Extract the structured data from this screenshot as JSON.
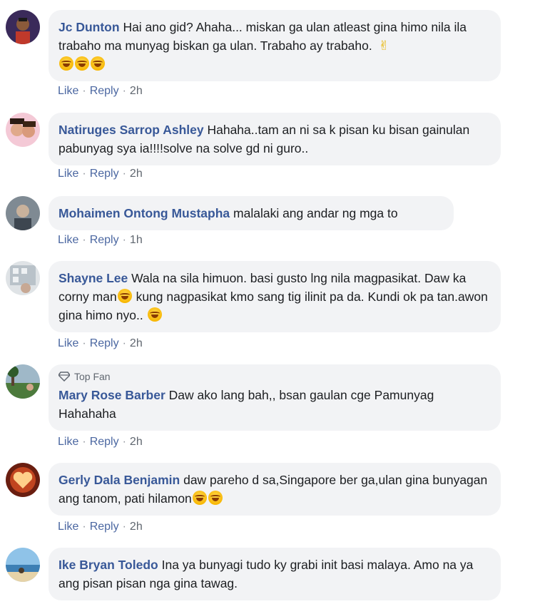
{
  "comments": [
    {
      "name": "Jc Dunton",
      "text": "Hai ano gid? Ahaha... miskan ga ulan atleast gina himo nila ila trabaho ma munyag biskan ga ulan. Trabaho ay trabaho.",
      "like": "Like",
      "reply": "Reply",
      "time": "2h",
      "avatar": "avatar-young-man"
    },
    {
      "name": "Natiruges Sarrop Ashley",
      "text": "Hahaha..tam an ni sa k pisan ku bisan gainulan pabunyag sya ia!!!!solve na solve gd ni guro..",
      "like": "Like",
      "reply": "Reply",
      "time": "2h",
      "avatar": "avatar-two-people"
    },
    {
      "name": "Mohaimen Ontong Mustapha",
      "text": "malalaki ang andar ng mga to",
      "like": "Like",
      "reply": "Reply",
      "time": "1h",
      "avatar": "avatar-man-grey"
    },
    {
      "name": "Shayne Lee",
      "text1": "Wala na sila himuon. basi gusto lng nila magpasikat. Daw ka corny man",
      "text2": "kung nagpasikat kmo sang tig ilinit pa da. Kundi ok pa tan.awon gina himo nyo..",
      "like": "Like",
      "reply": "Reply",
      "time": "2h",
      "avatar": "avatar-building"
    },
    {
      "badge": "Top Fan",
      "name": "Mary Rose Barber",
      "text": "Daw ako lang bah,, bsan gaulan cge Pamunyag Hahahaha",
      "like": "Like",
      "reply": "Reply",
      "time": "2h",
      "avatar": "avatar-park"
    },
    {
      "name": "Gerly Dala Benjamin",
      "text": "daw pareho d sa,Singapore ber ga,ulan gina bunyagan ang tanom, pati hilamon",
      "like": "Like",
      "reply": "Reply",
      "time": "2h",
      "avatar": "avatar-heart"
    },
    {
      "name": "Ike Bryan Toledo",
      "text": "Ina ya bunyagi tudo ky grabi init basi malaya. Amo na ya ang pisan pisan nga gina tawag.",
      "avatar": "avatar-beach"
    }
  ],
  "colors": {
    "name": "#385898",
    "bubble": "#f2f3f5",
    "action": "#4b67a1",
    "time": "#606770"
  }
}
